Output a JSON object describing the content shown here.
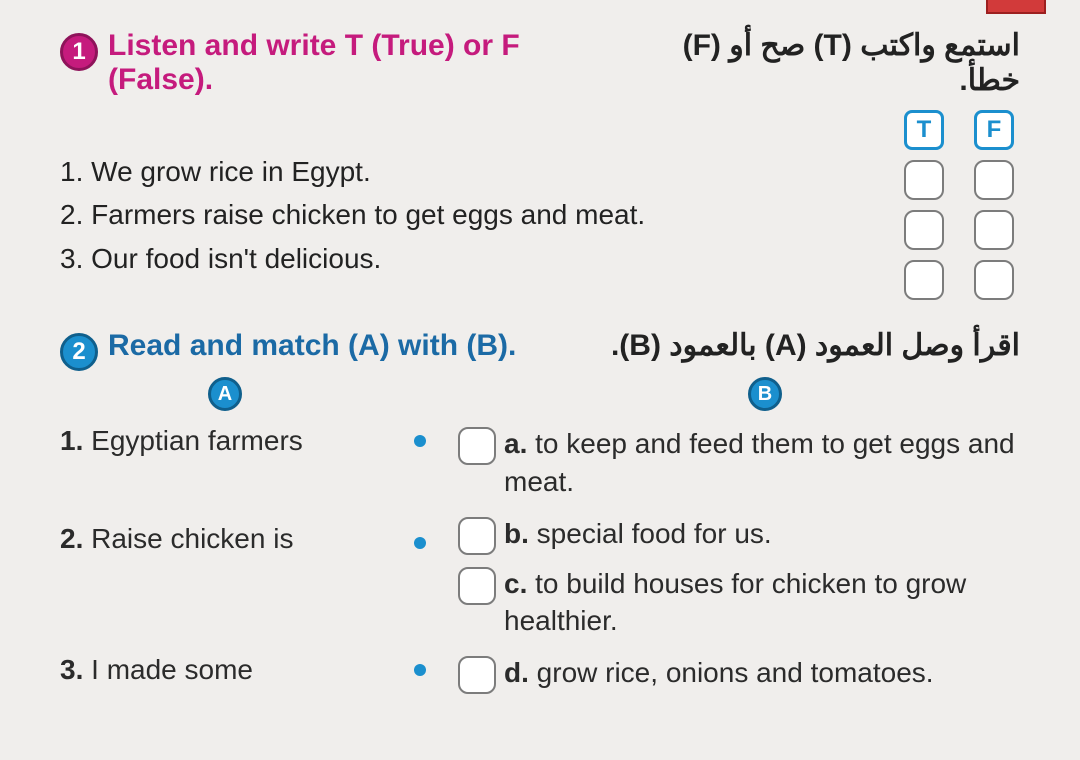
{
  "ex1": {
    "badge": "1",
    "instruction_en": "Listen and write T (True) or F (False).",
    "instruction_ar": "استمع واكتب (T) صح أو (F) خطأ.",
    "tf_headers": {
      "t": "T",
      "f": "F"
    },
    "statements": [
      {
        "n": "1.",
        "text": "We grow rice in Egypt."
      },
      {
        "n": "2.",
        "text": "Farmers raise chicken to get eggs and meat."
      },
      {
        "n": "3.",
        "text": "Our food isn't delicious."
      }
    ]
  },
  "ex2": {
    "badge": "2",
    "instruction_en": "Read and match (A) with (B).",
    "instruction_ar": "اقرأ وصل العمود (A) بالعمود (B).",
    "columns": {
      "a": "A",
      "b": "B"
    },
    "colA": [
      {
        "n": "1.",
        "text": "Egyptian farmers"
      },
      {
        "n": "2.",
        "text": "Raise chicken is"
      },
      {
        "n": "3.",
        "text": "I made some"
      }
    ],
    "colB": [
      {
        "n": "a.",
        "text": "to keep and feed them to get eggs and meat."
      },
      {
        "n": "b.",
        "text": "special food for us."
      },
      {
        "n": "c.",
        "text": "to build houses for chicken to grow healthier."
      },
      {
        "n": "d.",
        "text": "grow rice, onions and tomatoes."
      }
    ]
  }
}
